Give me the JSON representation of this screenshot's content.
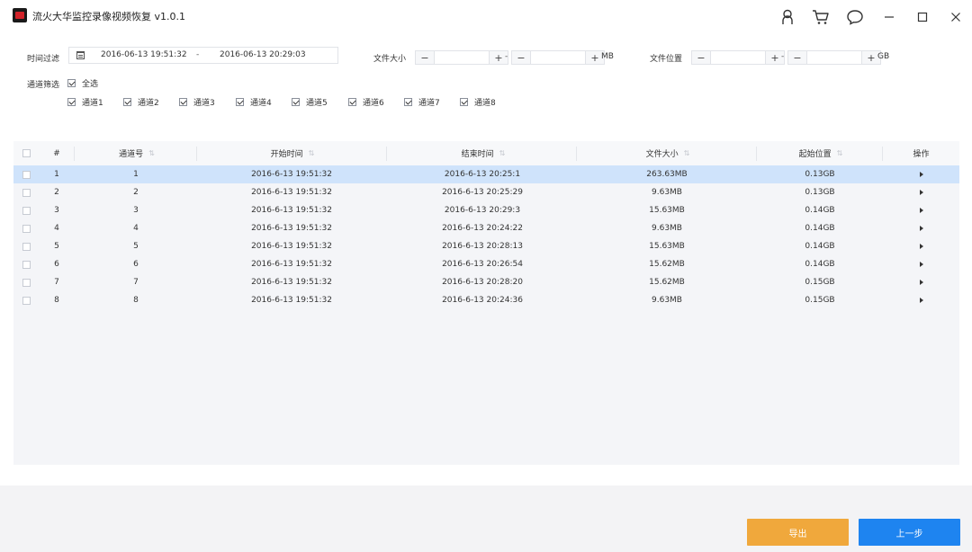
{
  "app": {
    "title": "流火大华监控录像视频恢复 v1.0.1"
  },
  "window_icons": {
    "user": "user-icon",
    "cart": "cart-icon",
    "chat": "chat-icon",
    "minimize": "minimize-icon",
    "maximize": "maximize-icon",
    "close": "close-icon"
  },
  "filter": {
    "time_label": "时间过滤",
    "start_time": "2016-06-13 19:51:32",
    "separator": "-",
    "end_time": "2016-06-13 20:29:03",
    "size_label": "文件大小",
    "size_unit": "MB",
    "position_label": "文件位置",
    "position_unit": "GB",
    "range_dash": "-",
    "stepper_minus": "−",
    "stepper_plus": "+",
    "channel_label": "通道筛选",
    "select_all": "全选",
    "channels": [
      "通道1",
      "通道2",
      "通道3",
      "通道4",
      "通道5",
      "通道6",
      "通道7",
      "通道8"
    ]
  },
  "table": {
    "headers": {
      "index": "#",
      "channel": "通道号",
      "start": "开始时间",
      "end": "结束时间",
      "size": "文件大小",
      "position": "起始位置",
      "action": "操作"
    },
    "rows": [
      {
        "index": "1",
        "channel": "1",
        "start": "2016-6-13 19:51:32",
        "end": "2016-6-13 20:25:1",
        "size": "263.63MB",
        "position": "0.13GB"
      },
      {
        "index": "2",
        "channel": "2",
        "start": "2016-6-13 19:51:32",
        "end": "2016-6-13 20:25:29",
        "size": "9.63MB",
        "position": "0.13GB"
      },
      {
        "index": "3",
        "channel": "3",
        "start": "2016-6-13 19:51:32",
        "end": "2016-6-13 20:29:3",
        "size": "15.63MB",
        "position": "0.14GB"
      },
      {
        "index": "4",
        "channel": "4",
        "start": "2016-6-13 19:51:32",
        "end": "2016-6-13 20:24:22",
        "size": "9.63MB",
        "position": "0.14GB"
      },
      {
        "index": "5",
        "channel": "5",
        "start": "2016-6-13 19:51:32",
        "end": "2016-6-13 20:28:13",
        "size": "15.63MB",
        "position": "0.14GB"
      },
      {
        "index": "6",
        "channel": "6",
        "start": "2016-6-13 19:51:32",
        "end": "2016-6-13 20:26:54",
        "size": "15.62MB",
        "position": "0.14GB"
      },
      {
        "index": "7",
        "channel": "7",
        "start": "2016-6-13 19:51:32",
        "end": "2016-6-13 20:28:20",
        "size": "15.62MB",
        "position": "0.15GB"
      },
      {
        "index": "8",
        "channel": "8",
        "start": "2016-6-13 19:51:32",
        "end": "2016-6-13 20:24:36",
        "size": "9.63MB",
        "position": "0.15GB"
      }
    ]
  },
  "footer": {
    "export_label": "导出",
    "prev_label": "上一步"
  },
  "colors": {
    "accent_blue": "#1e84f0",
    "accent_orange": "#f0a83c",
    "selected_row": "#cfe3fb"
  }
}
